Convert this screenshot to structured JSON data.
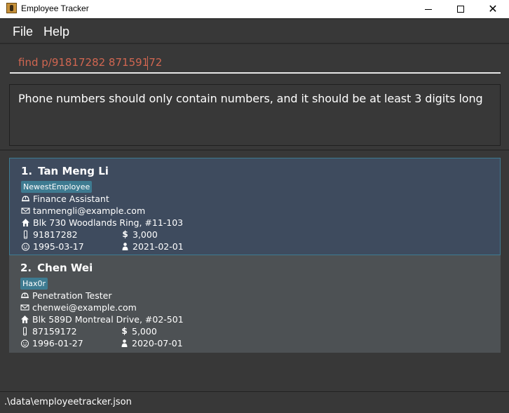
{
  "window": {
    "title": "Employee Tracker"
  },
  "menu": {
    "file": "File",
    "help": "Help"
  },
  "command": {
    "value": "find p/91817282 87159172"
  },
  "result": {
    "message": "Phone numbers should only contain numbers, and it should be at least 3 digits long"
  },
  "employees": [
    {
      "index": "1.",
      "name": "Tan Meng Li",
      "tag": "NewestEmployee",
      "role": "Finance Assistant",
      "email": "tanmengli@example.com",
      "address": "Blk 730 Woodlands Ring, #11-103",
      "phone": "91817282",
      "salary": "3,000",
      "birthday": "1995-03-17",
      "join_date": "2021-02-01",
      "selected": true
    },
    {
      "index": "2.",
      "name": "Chen Wei",
      "tag": "Hax0r",
      "role": "Penetration Tester",
      "email": "chenwei@example.com",
      "address": "Blk 589D Montreal Drive, #02-501",
      "phone": "87159172",
      "salary": "5,000",
      "birthday": "1996-01-27",
      "join_date": "2020-07-01",
      "selected": false
    }
  ],
  "status": {
    "path": ".\\data\\employeetracker.json"
  },
  "icons": {
    "app": "app-icon",
    "role": "hardhat-icon",
    "email": "mail-icon",
    "address": "home-icon",
    "phone": "phone-icon",
    "salary": "dollar-icon",
    "birthday": "cake-icon",
    "join_date": "person-icon"
  },
  "colors": {
    "background": "#383838",
    "selected_card": "#3e4b5e",
    "card": "#4d5154",
    "tag": "#3e7b91",
    "command_text": "#d06651"
  }
}
